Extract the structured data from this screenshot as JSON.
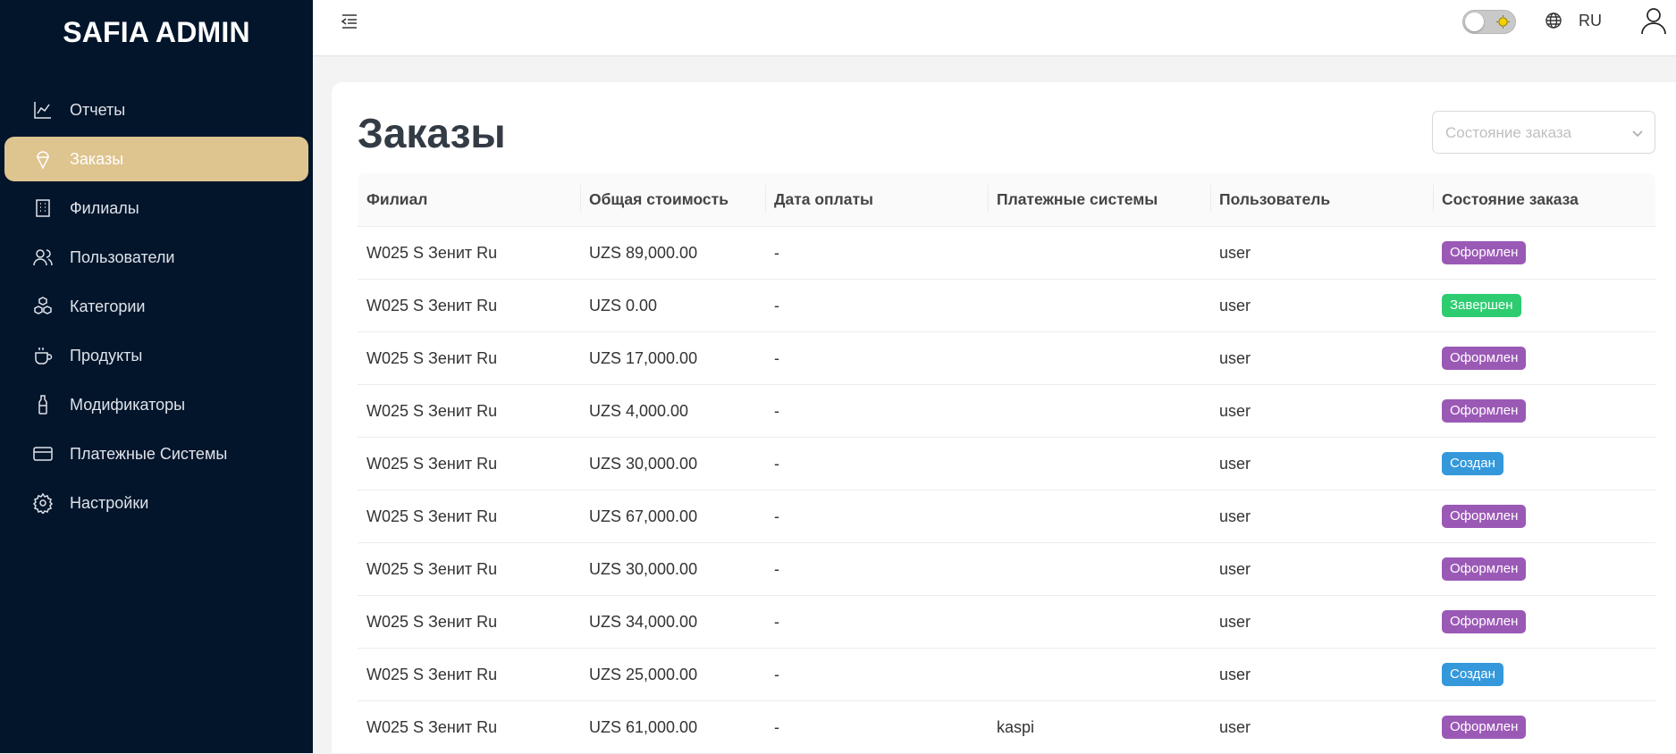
{
  "app": {
    "logo": "SAFIA ADMIN"
  },
  "sidebar": {
    "items": [
      {
        "label": "Отчеты",
        "icon": "chart-line-icon",
        "active": false
      },
      {
        "label": "Заказы",
        "icon": "ice-cream-icon",
        "active": true
      },
      {
        "label": "Филиалы",
        "icon": "building-icon",
        "active": false
      },
      {
        "label": "Пользователи",
        "icon": "users-icon",
        "active": false
      },
      {
        "label": "Категории",
        "icon": "cubes-icon",
        "active": false
      },
      {
        "label": "Продукты",
        "icon": "coffee-cup-icon",
        "active": false
      },
      {
        "label": "Модификаторы",
        "icon": "bottle-icon",
        "active": false
      },
      {
        "label": "Платежные Системы",
        "icon": "credit-card-icon",
        "active": false
      },
      {
        "label": "Настройки",
        "icon": "gear-icon",
        "active": false
      }
    ]
  },
  "header": {
    "language": "RU",
    "theme_toggle": {
      "state": "off"
    }
  },
  "main": {
    "title": "Заказы",
    "filter": {
      "placeholder": "Состояние заказа"
    },
    "table": {
      "columns": [
        "Филиал",
        "Общая стоимость",
        "Дата оплаты",
        "Платежные системы",
        "Пользователь",
        "Состояние заказа"
      ],
      "rows": [
        {
          "branch": "W025 S Зенит Ru",
          "total": "UZS 89,000.00",
          "paid_at": "-",
          "payment": "",
          "user": "user",
          "status": "Оформлен",
          "status_color": "#9b59b6"
        },
        {
          "branch": "W025 S Зенит Ru",
          "total": "UZS 0.00",
          "paid_at": "-",
          "payment": "",
          "user": "user",
          "status": "Завершен",
          "status_color": "#2ecc71"
        },
        {
          "branch": "W025 S Зенит Ru",
          "total": "UZS 17,000.00",
          "paid_at": "-",
          "payment": "",
          "user": "user",
          "status": "Оформлен",
          "status_color": "#9b59b6"
        },
        {
          "branch": "W025 S Зенит Ru",
          "total": "UZS 4,000.00",
          "paid_at": "-",
          "payment": "",
          "user": "user",
          "status": "Оформлен",
          "status_color": "#9b59b6"
        },
        {
          "branch": "W025 S Зенит Ru",
          "total": "UZS 30,000.00",
          "paid_at": "-",
          "payment": "",
          "user": "user",
          "status": "Создан",
          "status_color": "#3498db"
        },
        {
          "branch": "W025 S Зенит Ru",
          "total": "UZS 67,000.00",
          "paid_at": "-",
          "payment": "",
          "user": "user",
          "status": "Оформлен",
          "status_color": "#9b59b6"
        },
        {
          "branch": "W025 S Зенит Ru",
          "total": "UZS 30,000.00",
          "paid_at": "-",
          "payment": "",
          "user": "user",
          "status": "Оформлен",
          "status_color": "#9b59b6"
        },
        {
          "branch": "W025 S Зенит Ru",
          "total": "UZS 34,000.00",
          "paid_at": "-",
          "payment": "",
          "user": "user",
          "status": "Оформлен",
          "status_color": "#9b59b6"
        },
        {
          "branch": "W025 S Зенит Ru",
          "total": "UZS 25,000.00",
          "paid_at": "-",
          "payment": "",
          "user": "user",
          "status": "Создан",
          "status_color": "#3498db"
        },
        {
          "branch": "W025 S Зенит Ru",
          "total": "UZS 61,000.00",
          "paid_at": "-",
          "payment": "kaspi",
          "user": "user",
          "status": "Оформлен",
          "status_color": "#9b59b6"
        }
      ]
    }
  },
  "colors": {
    "sidebar_bg": "#03152b",
    "active_item": "#dec48e",
    "status_formalized": "#9b59b6",
    "status_completed": "#2ecc71",
    "status_created": "#3498db"
  }
}
